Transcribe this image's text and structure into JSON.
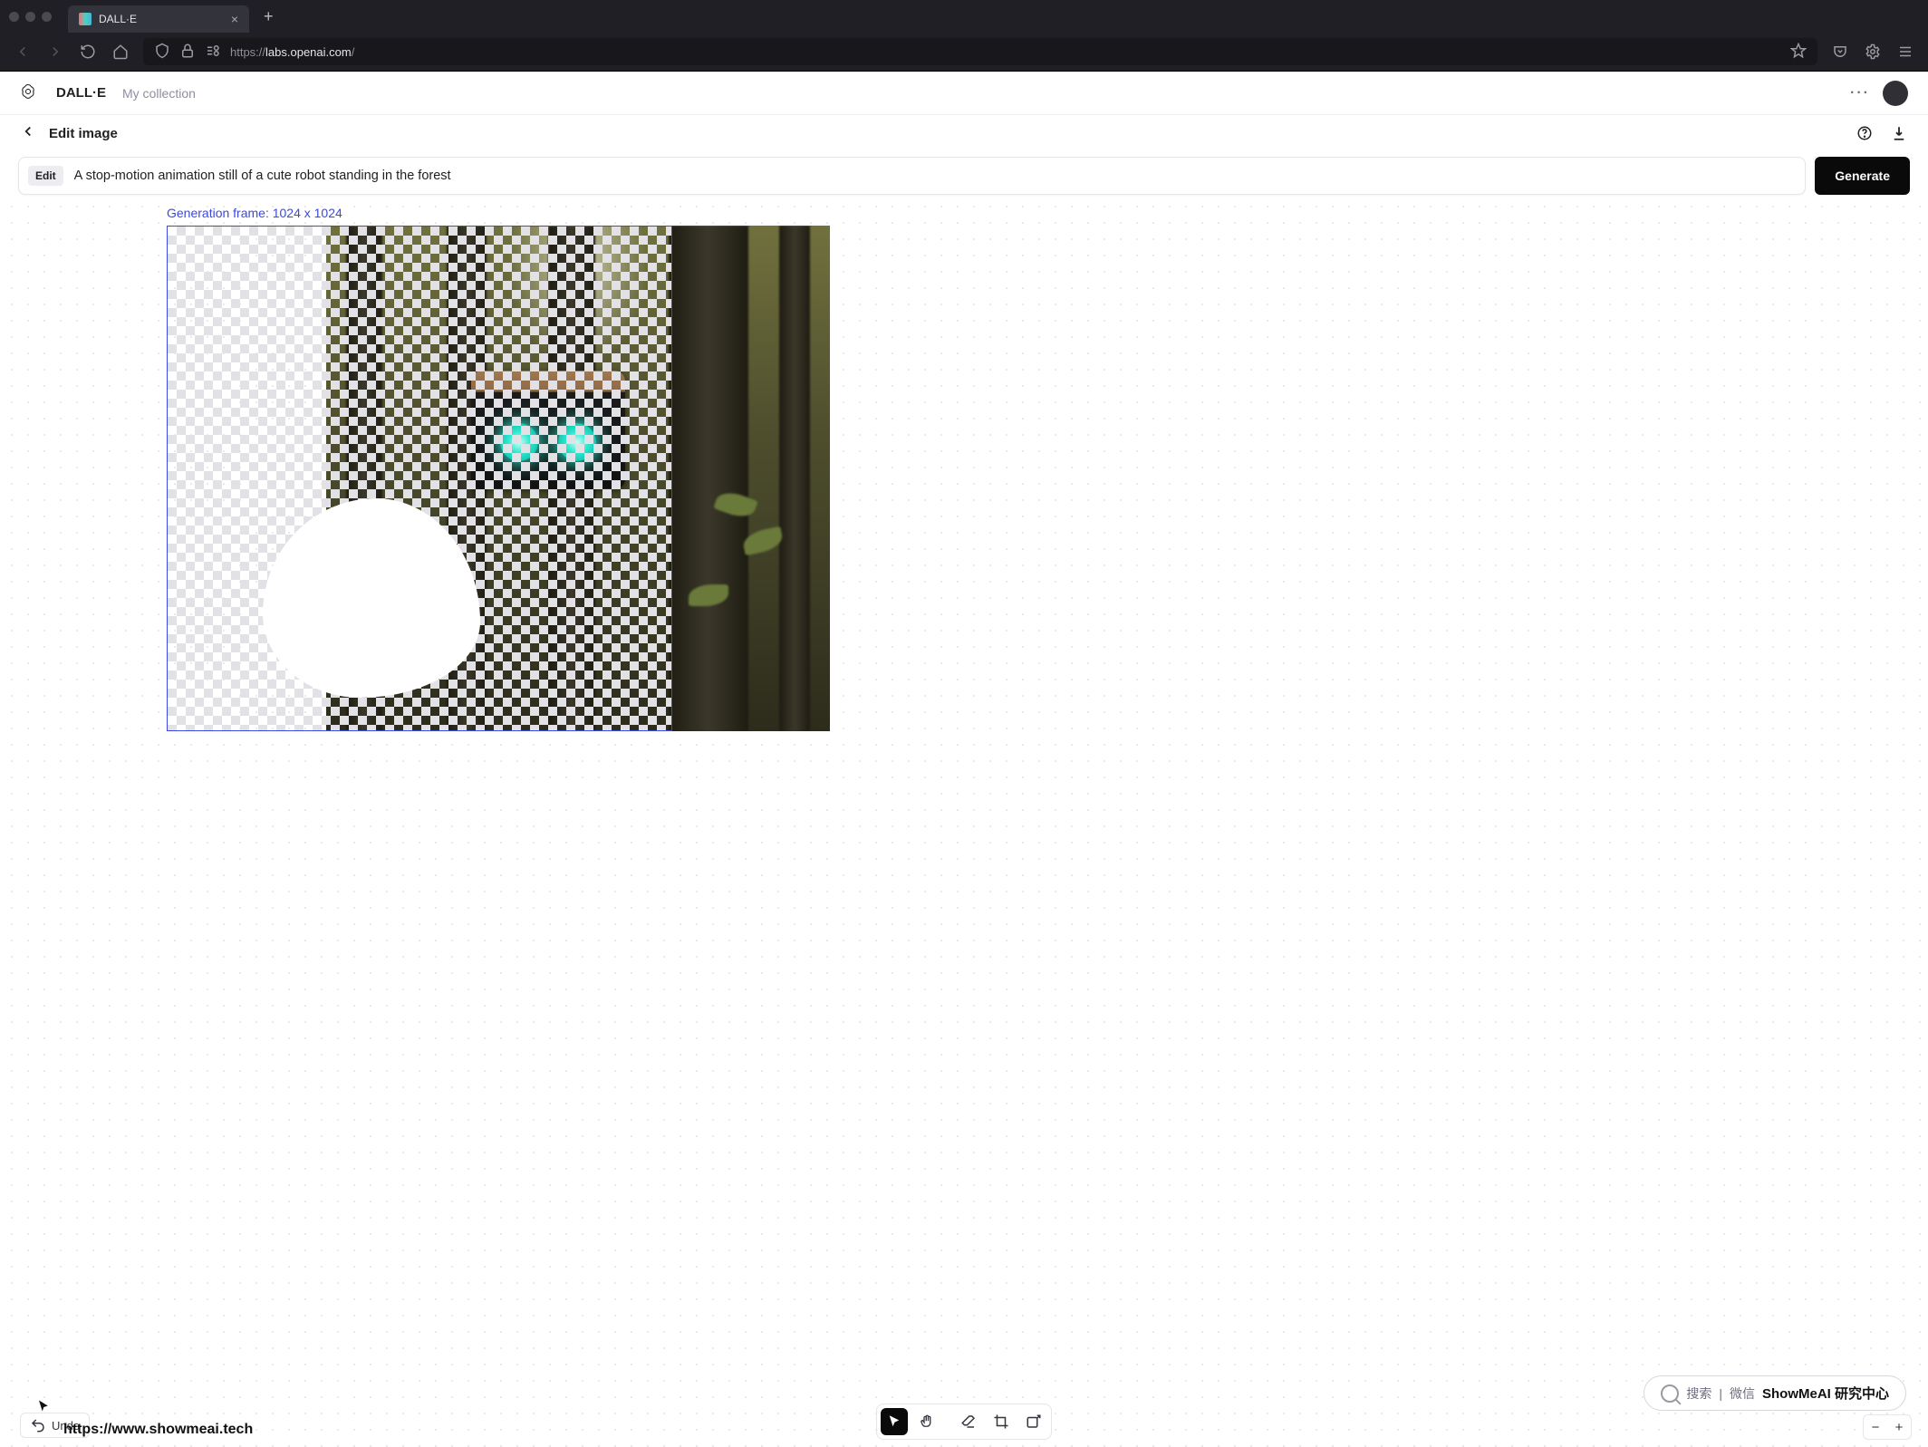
{
  "browser": {
    "tab_title": "DALL·E",
    "url_display": "https://labs.openai.com/",
    "url_host": "labs.openai.com"
  },
  "header": {
    "brand": "DALL·E",
    "collection_link": "My collection"
  },
  "subheader": {
    "title": "Edit image"
  },
  "prompt": {
    "badge": "Edit",
    "text": "A stop-motion animation still of a cute robot standing in the forest",
    "generate_label": "Generate"
  },
  "canvas": {
    "frame_label": "Generation frame: 1024 x 1024"
  },
  "footer": {
    "undo_label": "Undo",
    "status_url": "https://www.showmeai.tech"
  },
  "watermark": {
    "search_cn": "搜索",
    "wechat_cn": "微信",
    "brand": "ShowMeAI 研究中心"
  },
  "tools": {
    "pointer": "pointer",
    "pan": "pan",
    "eraser": "eraser",
    "crop": "crop",
    "add_frame": "add-generation-frame"
  }
}
